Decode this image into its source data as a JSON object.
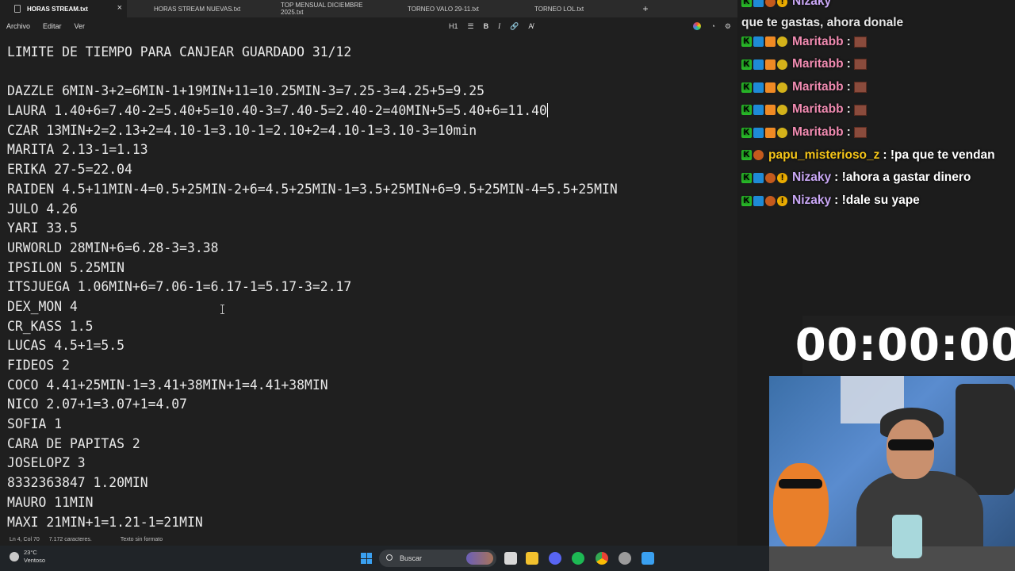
{
  "tabs": [
    {
      "label": "HORAS STREAM.txt",
      "active": true
    },
    {
      "label": "HORAS STREAM NUEVAS.txt",
      "active": false
    },
    {
      "label": "TOP MENSUAL DICIEMBRE 2025.txt",
      "active": false
    },
    {
      "label": "TORNEO VALO 29-11.txt",
      "active": false
    },
    {
      "label": "TORNEO LOL.txt",
      "active": false
    }
  ],
  "new_tab": "+",
  "close_glyph": "×",
  "menu": {
    "file": "Archivo",
    "edit": "Editar",
    "view": "Ver"
  },
  "format_toolbar": {
    "heading": "H1",
    "list": "☰",
    "bold": "B",
    "italic": "I",
    "link": "🔗",
    "clear": "A̸"
  },
  "editor_lines": [
    "LIMITE DE TIEMPO PARA CANJEAR GUARDADO 31/12",
    "",
    "DAZZLE 6MIN-3+2=6MIN-1+19MIN+11=10.25MIN-3=7.25-3=4.25+5=9.25",
    "LAURA 1.40+6=7.40-2=5.40+5=10.40-3=7.40-5=2.40-2=40MIN+5=5.40+6=11.40",
    "CZAR 13MIN+2=2.13+2=4.10-1=3.10-1=2.10+2=4.10-1=3.10-3=10min",
    "MARITA 2.13-1=1.13",
    "ERIKA 27-5=22.04",
    "RAIDEN 4.5+11MIN-4=0.5+25MIN-2+6=4.5+25MIN-1=3.5+25MIN+6=9.5+25MIN-4=5.5+25MIN",
    "JULO 4.26",
    "YARI 33.5",
    "URWORLD 28MIN+6=6.28-3=3.38",
    "IPSILON 5.25MIN",
    "ITSJUEGA 1.06MIN+6=7.06-1=6.17-1=5.17-3=2.17",
    "DEX_MON 4",
    "CR_KASS 1.5",
    "LUCAS 4.5+1=5.5",
    "FIDEOS 2",
    "COCO 4.41+25MIN-1=3.41+38MIN+1=4.41+38MIN",
    "NICO 2.07+1=3.07+1=4.07",
    "SOFIA 1",
    "CARA DE PAPITAS 2",
    "JOSELOPZ 3",
    "8332363847 1.20MIN",
    "MAURO 11MIN",
    "MAXI 21MIN+1=1.21-1=21MIN"
  ],
  "status": {
    "position": "Ln 4, Col 70",
    "chars": "7.172 caracteres.",
    "format": "Texto sin formato"
  },
  "chat": {
    "top_user": "Nizaky",
    "top_text": "que te gastas, ahora donale",
    "messages": [
      {
        "user": "Maritabb",
        "color": "#f08bb1",
        "text": ":"
      },
      {
        "user": "Maritabb",
        "color": "#f08bb1",
        "text": ":"
      },
      {
        "user": "Maritabb",
        "color": "#f08bb1",
        "text": ":"
      },
      {
        "user": "Maritabb",
        "color": "#f08bb1",
        "text": ":"
      },
      {
        "user": "Maritabb",
        "color": "#f08bb1",
        "text": ":"
      },
      {
        "user": "papu_misterioso_z",
        "color": "#f5c518",
        "text": ": !pa que te vendan"
      },
      {
        "user": "Nizaky",
        "color": "#c9a7f5",
        "text": ": !ahora a gastar dinero"
      },
      {
        "user": "Nizaky",
        "color": "#c9a7f5",
        "text": ": !dale su yape"
      }
    ]
  },
  "timer": "00:00:00",
  "taskbar": {
    "temp": "23°C",
    "weather": "Ventoso",
    "search": "Buscar"
  }
}
